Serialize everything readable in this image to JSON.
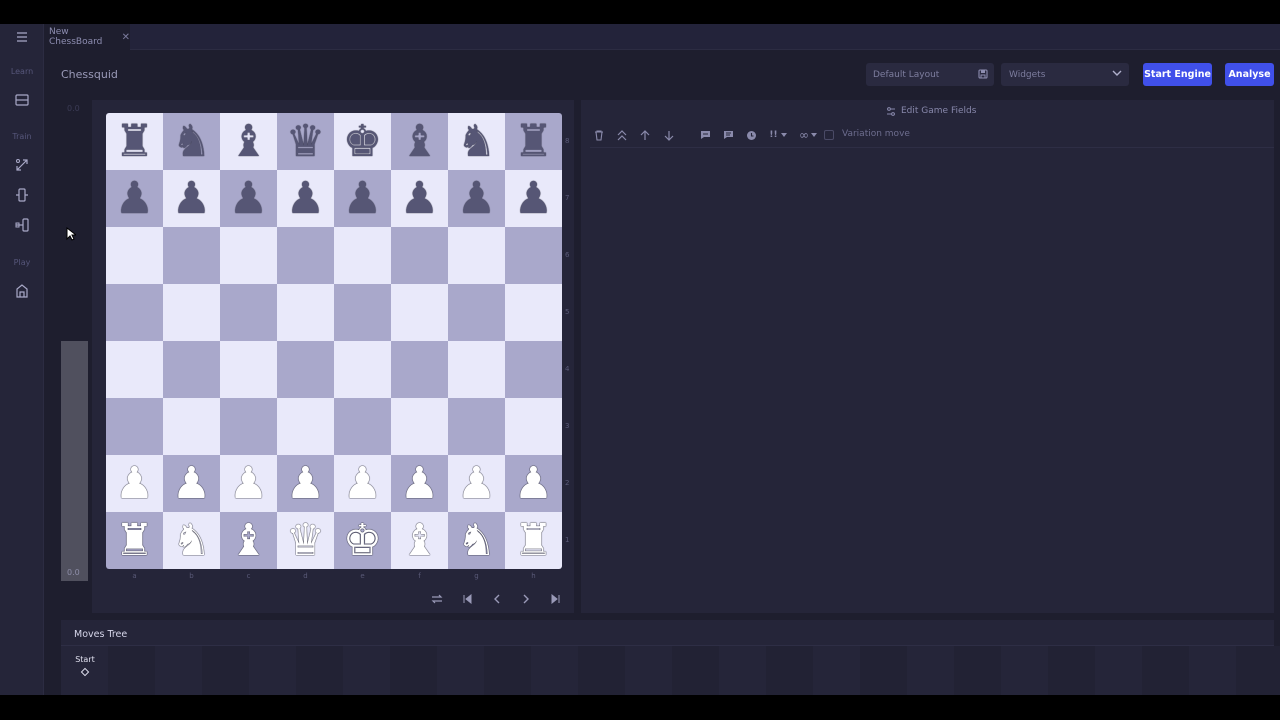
{
  "tab": {
    "label": "New ChessBoard",
    "close": "✕"
  },
  "sidebar": {
    "sections": [
      {
        "label": "Learn"
      },
      {
        "label": "Train"
      },
      {
        "label": "Play"
      }
    ]
  },
  "header": {
    "title": "Chessquid",
    "layout_value": "Default Layout",
    "widgets_placeholder": "Widgets",
    "start_engine": "Start Engine",
    "analyse": "Analyse"
  },
  "eval": {
    "top": "0.0",
    "bottom": "0.0"
  },
  "board": {
    "ranks": [
      "8",
      "7",
      "6",
      "5",
      "4",
      "3",
      "2",
      "1"
    ],
    "files": [
      "a",
      "b",
      "c",
      "d",
      "e",
      "f",
      "g",
      "h"
    ],
    "position": [
      [
        "r",
        "n",
        "b",
        "q",
        "k",
        "b",
        "n",
        "r"
      ],
      [
        "p",
        "p",
        "p",
        "p",
        "p",
        "p",
        "p",
        "p"
      ],
      [
        "",
        "",
        "",
        "",
        "",
        "",
        "",
        ""
      ],
      [
        "",
        "",
        "",
        "",
        "",
        "",
        "",
        ""
      ],
      [
        "",
        "",
        "",
        "",
        "",
        "",
        "",
        ""
      ],
      [
        "",
        "",
        "",
        "",
        "",
        "",
        "",
        ""
      ],
      [
        "P",
        "P",
        "P",
        "P",
        "P",
        "P",
        "P",
        "P"
      ],
      [
        "R",
        "N",
        "B",
        "Q",
        "K",
        "B",
        "N",
        "R"
      ]
    ],
    "colors": {
      "light": "#e9e9fa",
      "dark": "#a9a8cb"
    }
  },
  "notation": {
    "edit_fields": "Edit Game Fields",
    "annotation_glyph": "!!",
    "eval_glyph": "∞",
    "variation_label": "Variation move"
  },
  "moves_tree": {
    "title": "Moves Tree",
    "start": "Start"
  },
  "accent": "#4050ea"
}
